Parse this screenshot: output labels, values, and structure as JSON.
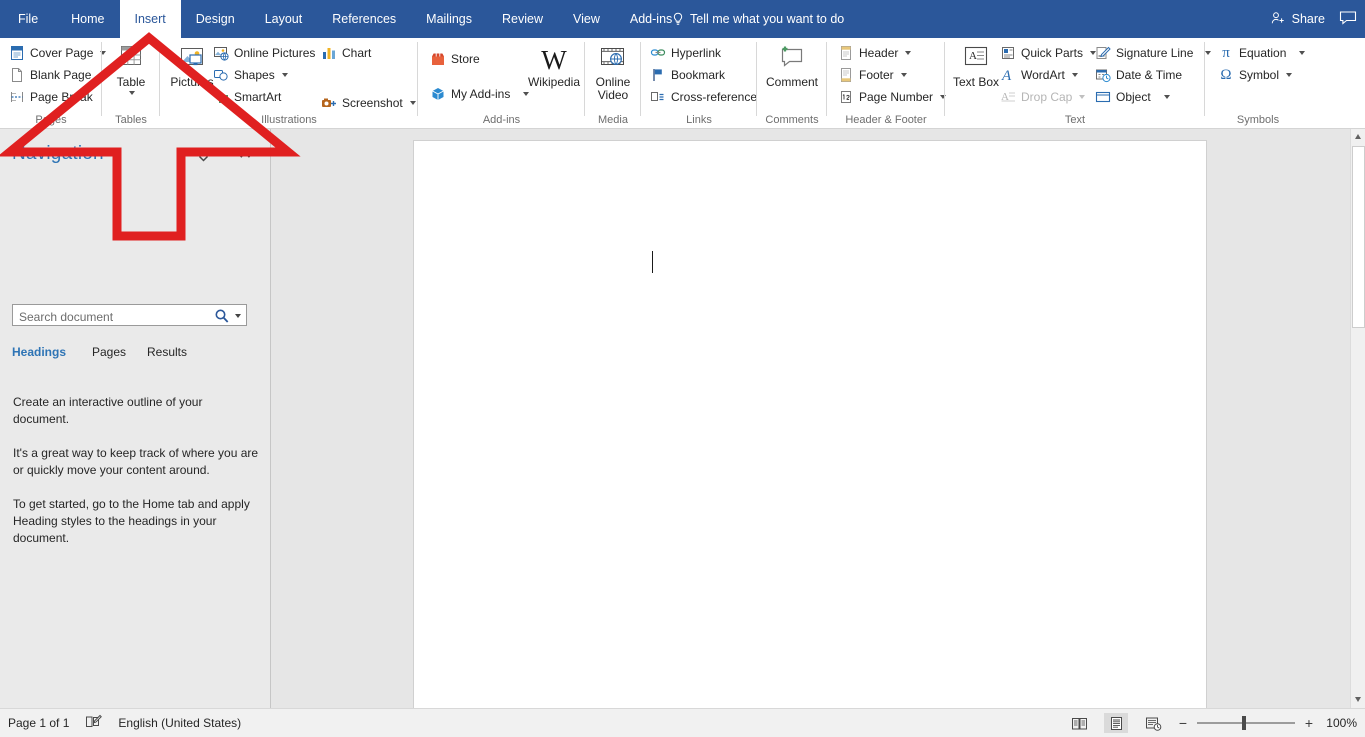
{
  "window": {
    "accent_color": "#2b579a",
    "tabs": [
      {
        "label": "File",
        "active": false
      },
      {
        "label": "Home",
        "active": false
      },
      {
        "label": "Insert",
        "active": true
      },
      {
        "label": "Design",
        "active": false
      },
      {
        "label": "Layout",
        "active": false
      },
      {
        "label": "References",
        "active": false
      },
      {
        "label": "Mailings",
        "active": false
      },
      {
        "label": "Review",
        "active": false
      },
      {
        "label": "View",
        "active": false
      },
      {
        "label": "Add-ins",
        "active": false
      }
    ],
    "tell_me": "Tell me what you want to do",
    "share_label": "Share"
  },
  "ribbon": {
    "groups": [
      {
        "name": "Pages",
        "commands": [
          {
            "label": "Cover Page",
            "icon": "cover-page-icon",
            "dropdown": true
          },
          {
            "label": "Blank Page",
            "icon": "blank-page-icon",
            "dropdown": false
          },
          {
            "label": "Page Break",
            "icon": "page-break-icon",
            "dropdown": false
          }
        ]
      },
      {
        "name": "Tables",
        "commands": [
          {
            "label": "Table",
            "icon": "table-icon",
            "dropdown": true
          }
        ]
      },
      {
        "name": "Illustrations",
        "commands": [
          {
            "label": "Pictures",
            "icon": "pictures-icon",
            "dropdown": false
          },
          {
            "label": "Online Pictures",
            "icon": "online-pictures-icon",
            "dropdown": false
          },
          {
            "label": "Shapes",
            "icon": "shapes-icon",
            "dropdown": true
          },
          {
            "label": "SmartArt",
            "icon": "smartart-icon",
            "dropdown": false
          },
          {
            "label": "Chart",
            "icon": "chart-icon",
            "dropdown": false
          },
          {
            "label": "Screenshot",
            "icon": "screenshot-icon",
            "dropdown": true
          }
        ]
      },
      {
        "name": "Add-ins",
        "commands": [
          {
            "label": "Store",
            "icon": "store-icon",
            "dropdown": false
          },
          {
            "label": "My Add-ins",
            "icon": "my-addins-icon",
            "dropdown": true
          },
          {
            "label": "Wikipedia",
            "icon": "wikipedia-icon",
            "dropdown": false
          }
        ]
      },
      {
        "name": "Media",
        "commands": [
          {
            "label": "Online Video",
            "icon": "online-video-icon",
            "dropdown": false
          }
        ]
      },
      {
        "name": "Links",
        "commands": [
          {
            "label": "Hyperlink",
            "icon": "hyperlink-icon",
            "dropdown": false
          },
          {
            "label": "Bookmark",
            "icon": "bookmark-icon",
            "dropdown": false
          },
          {
            "label": "Cross-reference",
            "icon": "cross-reference-icon",
            "dropdown": false
          }
        ]
      },
      {
        "name": "Comments",
        "commands": [
          {
            "label": "Comment",
            "icon": "comment-icon",
            "dropdown": false
          }
        ]
      },
      {
        "name": "Header & Footer",
        "commands": [
          {
            "label": "Header",
            "icon": "header-icon",
            "dropdown": true
          },
          {
            "label": "Footer",
            "icon": "footer-icon",
            "dropdown": true
          },
          {
            "label": "Page Number",
            "icon": "page-number-icon",
            "dropdown": true
          }
        ]
      },
      {
        "name": "Text",
        "commands": [
          {
            "label": "Text Box",
            "icon": "text-box-icon",
            "dropdown": true
          },
          {
            "label": "Quick Parts",
            "icon": "quick-parts-icon",
            "dropdown": true
          },
          {
            "label": "WordArt",
            "icon": "wordart-icon",
            "dropdown": true
          },
          {
            "label": "Drop Cap",
            "icon": "drop-cap-icon",
            "dropdown": true,
            "disabled": true
          },
          {
            "label": "Signature Line",
            "icon": "signature-line-icon",
            "dropdown": true
          },
          {
            "label": "Date & Time",
            "icon": "date-time-icon",
            "dropdown": false
          },
          {
            "label": "Object",
            "icon": "object-icon",
            "dropdown": true
          }
        ]
      },
      {
        "name": "Symbols",
        "commands": [
          {
            "label": "Equation",
            "icon": "equation-icon",
            "dropdown": true
          },
          {
            "label": "Symbol",
            "icon": "symbol-icon",
            "dropdown": true
          }
        ]
      }
    ]
  },
  "navigation": {
    "title": "Navigation",
    "search_placeholder": "Search document",
    "search_value": "",
    "tabs": [
      {
        "label": "Headings",
        "selected": true
      },
      {
        "label": "Pages",
        "selected": false
      },
      {
        "label": "Results",
        "selected": false
      }
    ],
    "body": [
      "Create an interactive outline of your document.",
      "It's a great way to keep track of where you are or quickly move your content around.",
      "To get started, go to the Home tab and apply Heading styles to the headings in your document."
    ],
    "title_color": "#2e74b5"
  },
  "status_bar": {
    "page_info": "Page 1 of 1",
    "language": "English (United States)",
    "proofing_icon": "proofing-errors-icon",
    "views": [
      {
        "name": "read-mode-view",
        "selected": false
      },
      {
        "name": "print-layout-view",
        "selected": true
      },
      {
        "name": "web-layout-view",
        "selected": false
      }
    ],
    "zoom_out": "−",
    "zoom_in": "+",
    "zoom_level": "100%"
  },
  "annotation": {
    "shape": "up-arrow-outline",
    "color": "#e02020",
    "stroke_width": 9
  }
}
